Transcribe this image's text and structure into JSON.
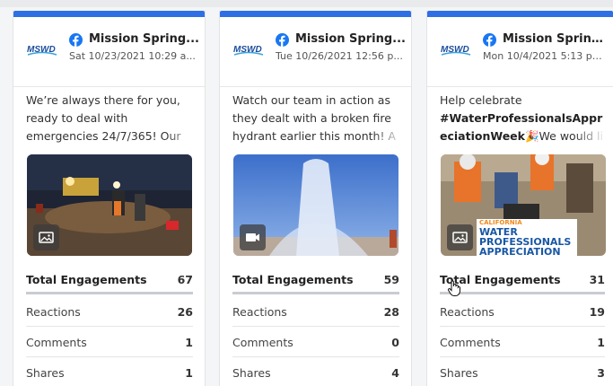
{
  "brand": {
    "logo_text": "MSWD",
    "accent_color": "#2f6fe4",
    "facebook_color": "#1877f2"
  },
  "labels": {
    "total": "Total Engagements",
    "reactions": "Reactions",
    "comments": "Comments",
    "shares": "Shares"
  },
  "posts": [
    {
      "account": "Mission Spring...",
      "date": "Sat 10/23/2021 10:29 a...",
      "text": "We’re always there for you, ready to deal with emergencies 24/7/365! Our",
      "media_icon": "image-icon",
      "total": "67",
      "reactions": "26",
      "comments": "1",
      "shares": "1"
    },
    {
      "account": "Mission Spring...",
      "date": "Tue 10/26/2021 12:56 p...",
      "text": "Watch our team in action as they dealt with a broken fire hydrant earlier this month! A",
      "media_icon": "video-icon",
      "total": "59",
      "reactions": "28",
      "comments": "0",
      "shares": "4"
    },
    {
      "account": "Mission Spring...",
      "date": "Mon 10/4/2021 5:13 pm ...",
      "text_lead": "Help celebrate",
      "text_tag": "#WaterProfessionalsAppreciationWeek",
      "text_emoji": "🎉",
      "text_tail": "We would li",
      "media_icon": "image-icon",
      "media_badge_line1": "CALIFORNIA",
      "media_badge_line2": "WATER",
      "media_badge_line3": "PROFESSIONALS",
      "media_badge_line4": "APPRECIATION",
      "total": "31",
      "reactions": "19",
      "comments": "1",
      "shares": "3"
    }
  ]
}
